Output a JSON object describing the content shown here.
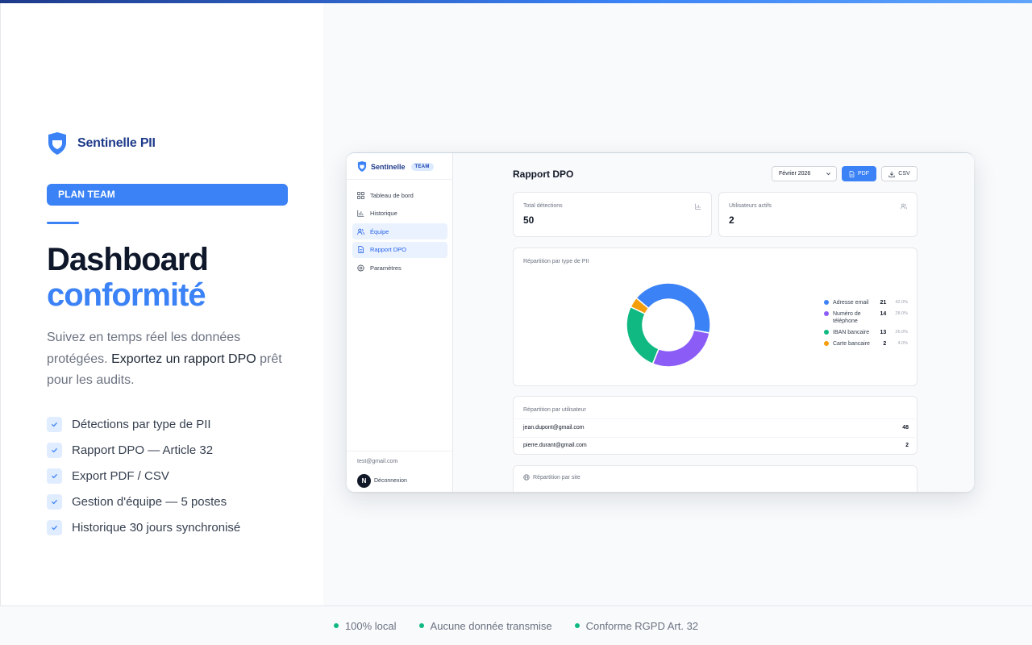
{
  "brand": {
    "name": "Sentinelle PII"
  },
  "plan": {
    "label": "PLAN TEAM"
  },
  "hero": {
    "title_line1": "Dashboard",
    "title_line2": "conformité",
    "desc_part1": "Suivez en temps réel les données protégées.",
    "desc_strong": "Exportez un rapport DPO",
    "desc_part2": "prêt pour les audits."
  },
  "features": [
    "Détections par type de PII",
    "Rapport DPO — Article 32",
    "Export PDF / CSV",
    "Gestion d'équipe — 5 postes",
    "Historique 30 jours synchronisé"
  ],
  "footer": [
    "100% local",
    "Aucune donnée transmise",
    "Conforme RGPD Art. 32"
  ],
  "colors": {
    "accent": "#3b82f6",
    "brand_dark": "#1e3a8a",
    "success": "#10b981"
  },
  "app": {
    "brand": "Sentinelle",
    "badge": "TEAM",
    "nav": [
      {
        "label": "Tableau de bord",
        "icon": "grid-icon",
        "active": false
      },
      {
        "label": "Historique",
        "icon": "bar-chart-icon",
        "active": false
      },
      {
        "label": "Équipe",
        "icon": "users-icon",
        "active": true
      },
      {
        "label": "Rapport DPO",
        "icon": "document-icon",
        "active": true
      },
      {
        "label": "Paramètres",
        "icon": "gear-icon",
        "active": false
      }
    ],
    "user_email": "test@gmail.com",
    "logout_label": "Déconnexion",
    "avatar_letter": "N",
    "page_title": "Rapport DPO",
    "month": "Février 2026",
    "pdf_label": "PDF",
    "csv_label": "CSV",
    "stats": {
      "total_label": "Total détections",
      "total_value": "50",
      "users_label": "Utilisateurs actifs",
      "users_value": "2"
    },
    "pii_card_title": "Répartition par type de PII",
    "users_card_title": "Répartition par utilisateur",
    "users": [
      {
        "email": "jean.dupont@gmail.com",
        "count": "48"
      },
      {
        "email": "pierre.durant@gmail.com",
        "count": "2"
      }
    ],
    "site_card_title": "Répartition par site"
  },
  "chart_data": {
    "type": "pie",
    "title": "Répartition par type de PII",
    "labels": [
      "Adresse email",
      "Numéro de téléphone",
      "IBAN bancaire",
      "Carte bancaire"
    ],
    "values": [
      21,
      14,
      13,
      2
    ],
    "percent_labels": [
      "42.0%",
      "28.0%",
      "26.0%",
      "4.0%"
    ],
    "colors": [
      "#3b82f6",
      "#8b5cf6",
      "#10b981",
      "#f59e0b"
    ],
    "legend": "right"
  }
}
